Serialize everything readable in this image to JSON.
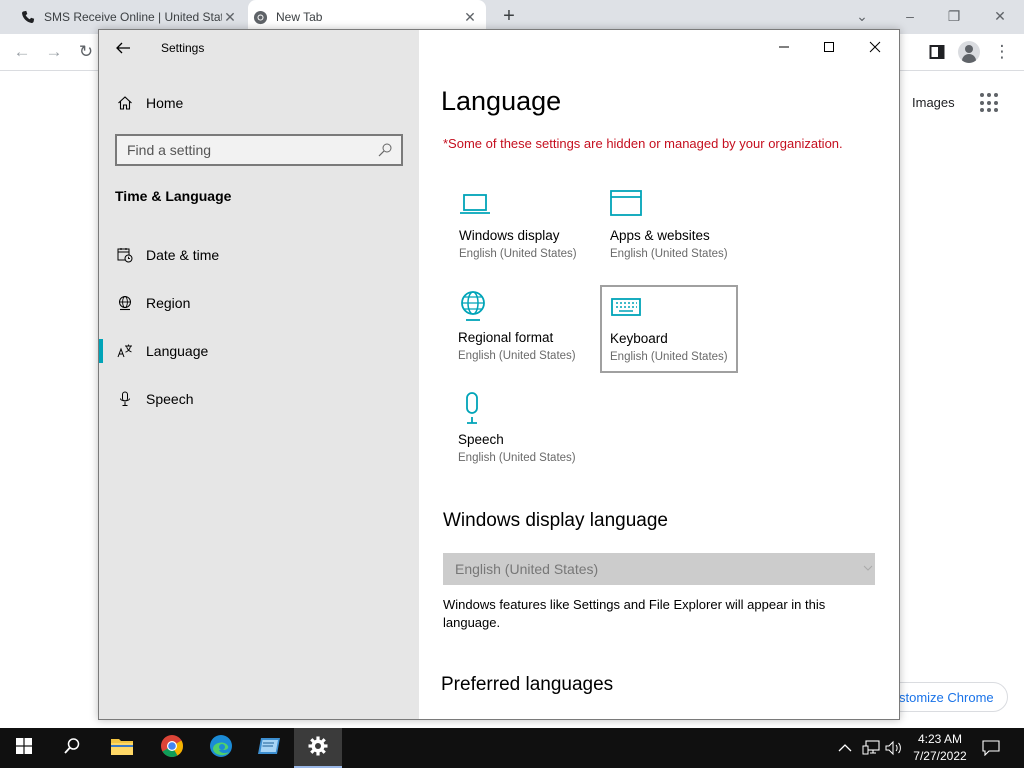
{
  "browser": {
    "tabs": [
      {
        "label": "SMS Receive Online | United Stat",
        "icon": "phone-icon"
      },
      {
        "label": "New Tab",
        "icon": "chrome-icon"
      }
    ],
    "images_link": "Images",
    "customize_chip": "stomize Chrome"
  },
  "settings": {
    "window_title": "Settings",
    "nav": {
      "home": "Home",
      "search_placeholder": "Find a setting",
      "section": "Time & Language",
      "items": [
        {
          "label": "Date & time",
          "icon": "calendar-clock-icon"
        },
        {
          "label": "Region",
          "icon": "globe-icon"
        },
        {
          "label": "Language",
          "icon": "language-icon",
          "active": true
        },
        {
          "label": "Speech",
          "icon": "microphone-icon"
        }
      ]
    },
    "page": {
      "title": "Language",
      "org_note": "*Some of these settings are hidden or managed by your organization.",
      "tiles": [
        {
          "name": "Windows display",
          "sub": "English (United States)",
          "icon": "laptop-icon"
        },
        {
          "name": "Apps & websites",
          "sub": "English (United States)",
          "icon": "window-icon"
        },
        {
          "name": "Regional format",
          "sub": "English (United States)",
          "icon": "globe-icon"
        },
        {
          "name": "Keyboard",
          "sub": "English (United States)",
          "icon": "keyboard-icon"
        },
        {
          "name": "Speech",
          "sub": "English (United States)",
          "icon": "microphone-icon"
        }
      ],
      "display_language_heading": "Windows display language",
      "display_language_value": "English (United States)",
      "display_language_desc": "Windows features like Settings and File Explorer will appear in this language.",
      "preferred_heading": "Preferred languages"
    },
    "accent_color": "#00a4b8"
  },
  "taskbar": {
    "time": "4:23 AM",
    "date": "7/27/2022"
  }
}
